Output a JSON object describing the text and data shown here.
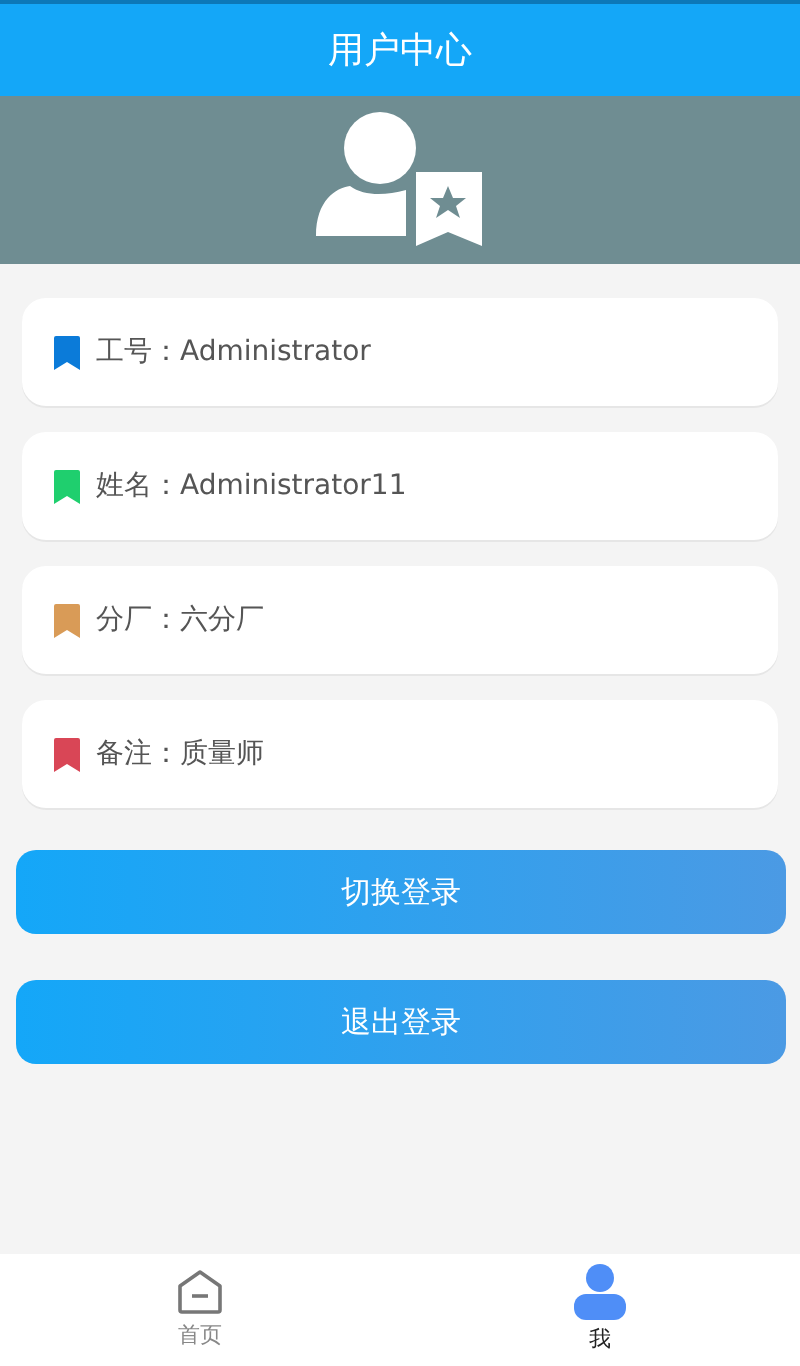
{
  "header": {
    "title": "用户中心"
  },
  "info_rows": [
    {
      "label": "工号：",
      "value": "Administrator",
      "color": "#0b7bd9"
    },
    {
      "label": "姓名：",
      "value": "Administrator11",
      "color": "#1fcf6e"
    },
    {
      "label": "分厂：",
      "value": "六分厂",
      "color": "#d99b57"
    },
    {
      "label": "备注：",
      "value": "质量师",
      "color": "#d94656"
    }
  ],
  "buttons": [
    "切换登录",
    "退出登录"
  ],
  "tabs": [
    {
      "label": "首页",
      "kind": "home",
      "selected": false
    },
    {
      "label": "我",
      "kind": "user",
      "selected": true
    }
  ]
}
